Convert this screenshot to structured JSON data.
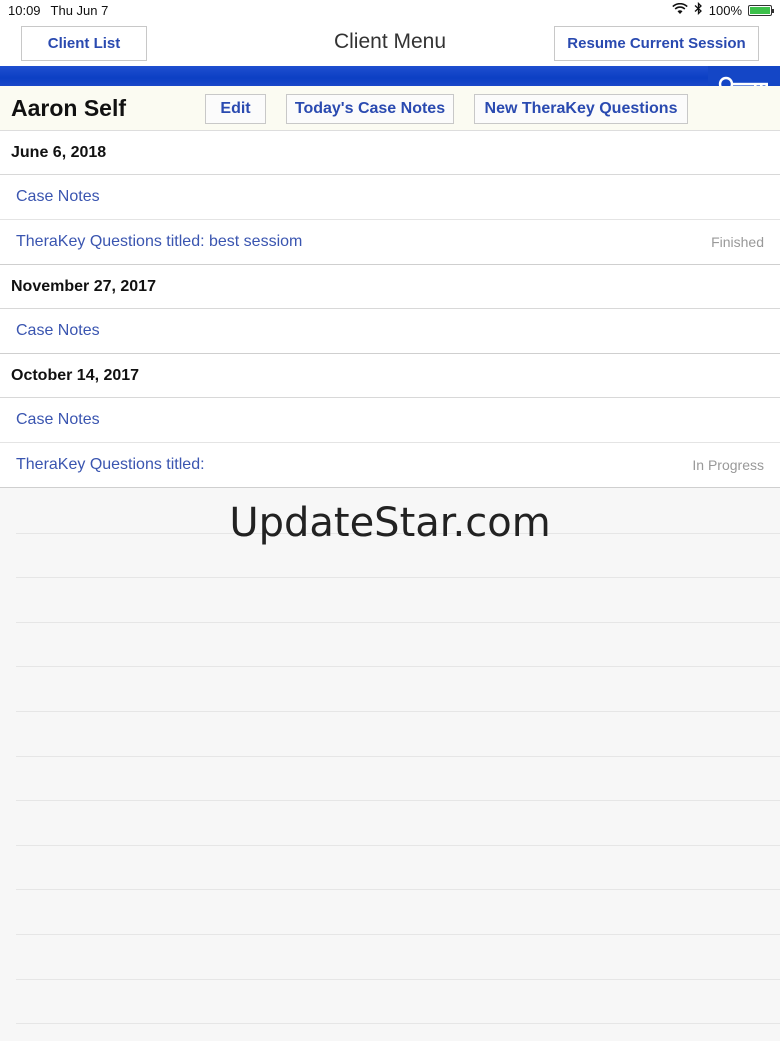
{
  "status_bar": {
    "time": "10:09",
    "date": "Thu Jun 7",
    "battery": "100%"
  },
  "nav": {
    "left_button": "Client List",
    "title": "Client Menu",
    "right_button": "Resume Current Session"
  },
  "client": {
    "name": "Aaron Self",
    "edit_label": "Edit",
    "today_notes_label": "Today's Case Notes",
    "new_questions_label": "New TheraKey Questions"
  },
  "sessions": [
    {
      "date": "June 6, 2018",
      "items": [
        {
          "label": "Case Notes",
          "status": ""
        },
        {
          "label": "TheraKey Questions titled: best sessiom",
          "status": "Finished"
        }
      ]
    },
    {
      "date": "November 27, 2017",
      "items": [
        {
          "label": "Case Notes",
          "status": ""
        }
      ]
    },
    {
      "date": "October 14, 2017",
      "items": [
        {
          "label": "Case Notes",
          "status": ""
        },
        {
          "label": "TheraKey Questions titled:",
          "status": "In Progress"
        }
      ]
    }
  ],
  "watermark": "UpdateStar.com",
  "colors": {
    "accent": "#2a4ab0",
    "band": "#0c3fc4",
    "link": "#3a55b0"
  },
  "icons": {
    "key": "key-icon",
    "wifi": "wifi-icon",
    "bluetooth": "bluetooth-icon",
    "battery": "battery-icon"
  }
}
